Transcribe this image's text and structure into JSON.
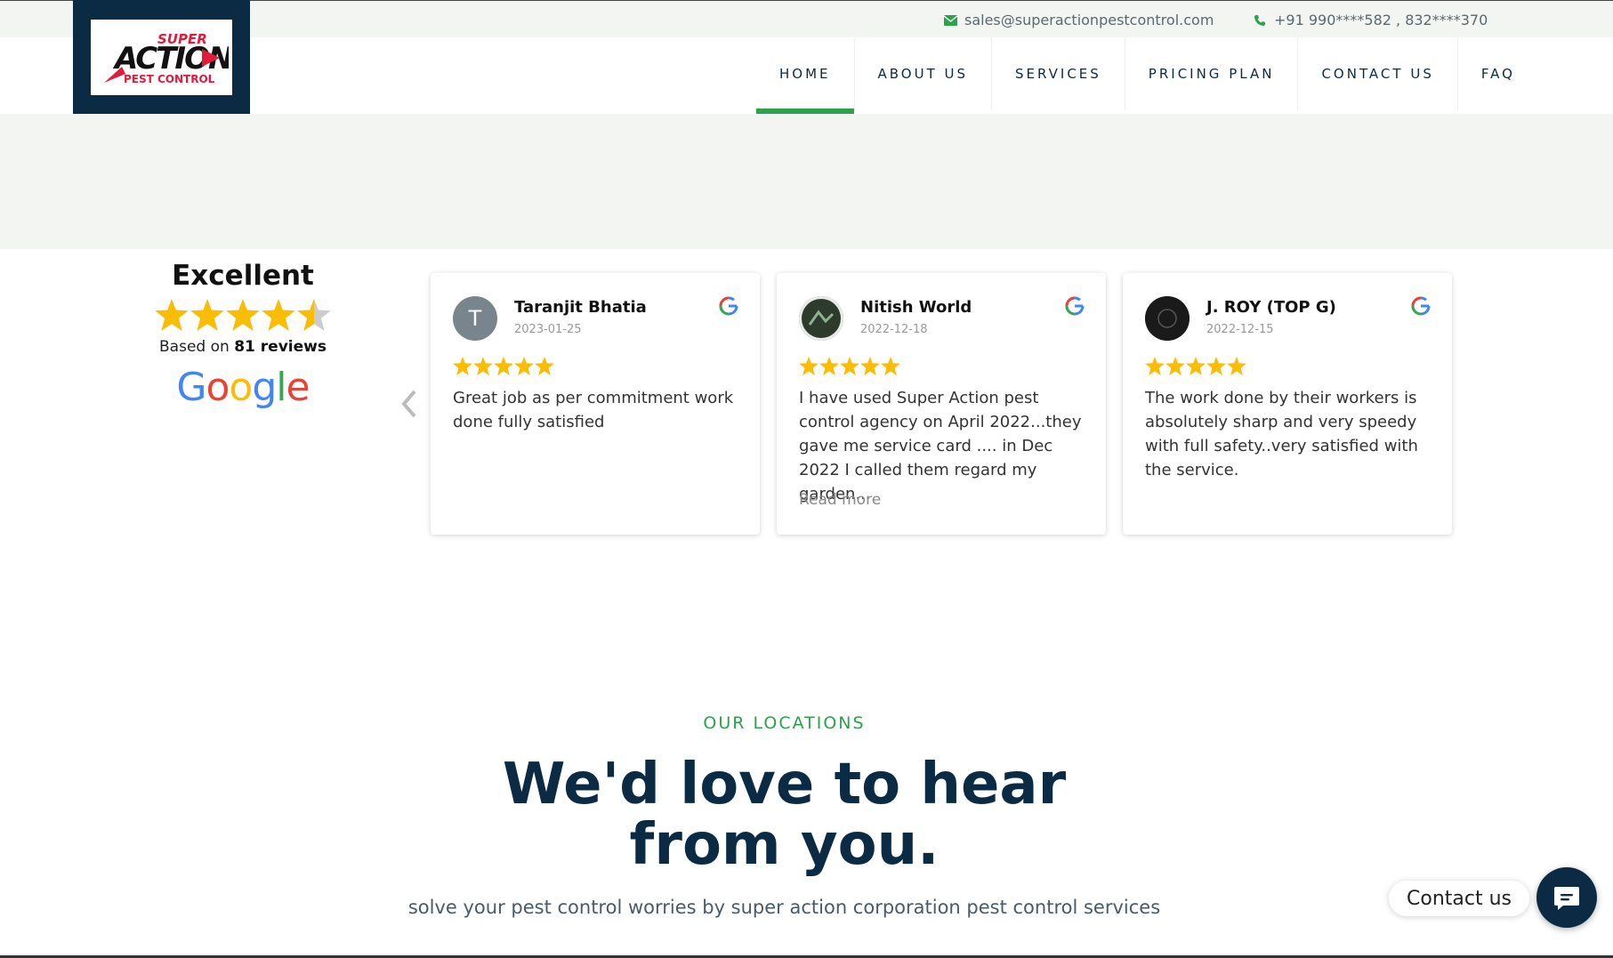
{
  "topbar": {
    "email": "sales@superactionpestcontrol.com",
    "phone": "+91 990****582 , 832****370",
    "email_icon": "envelope-icon",
    "phone_icon": "phone-icon"
  },
  "logo": {
    "line1": "SUPER",
    "line2": "ACTION",
    "line3": "PEST CONTROL"
  },
  "nav": {
    "items": [
      {
        "label": "HOME",
        "active": true
      },
      {
        "label": "ABOUT US",
        "active": false
      },
      {
        "label": "SERVICES",
        "active": false
      },
      {
        "label": "PRICING PLAN",
        "active": false
      },
      {
        "label": "CONTACT US",
        "active": false
      },
      {
        "label": "FAQ",
        "active": false
      }
    ]
  },
  "reviews_summary": {
    "heading": "Excellent",
    "rating": 4.5,
    "based_prefix": "Based on",
    "based_count": "81 reviews",
    "provider": "Google"
  },
  "reviews": [
    {
      "name": "Taranjit Bhatia",
      "date": "2023-01-25",
      "stars": 5,
      "avatar_letter": "T",
      "text": "Great job as per commitment work done fully satisfied",
      "read_more": ""
    },
    {
      "name": "Nitish World",
      "date": "2022-12-18",
      "stars": 5,
      "avatar_letter": "",
      "text": "I have used Super Action pest control agency on April 2022...they gave me service card .... in Dec 2022 I called them regard my garden...",
      "read_more": "Read more"
    },
    {
      "name": "J. ROY (TOP G)",
      "date": "2022-12-15",
      "stars": 5,
      "avatar_letter": "",
      "text": "The work done by their workers is absolutely sharp and very speedy with full safety..very satisfied with the service.",
      "read_more": ""
    }
  ],
  "locations": {
    "eyebrow": "OUR LOCATIONS",
    "title": "We'd love to hear from you.",
    "subtitle": "solve your pest control worries by super action corporation pest control services"
  },
  "contact_widget": {
    "label": "Contact us"
  },
  "colors": {
    "navy": "#0b2b44",
    "green": "#2ca24a",
    "star": "#fbbc04",
    "band": "#f3f5f2"
  }
}
